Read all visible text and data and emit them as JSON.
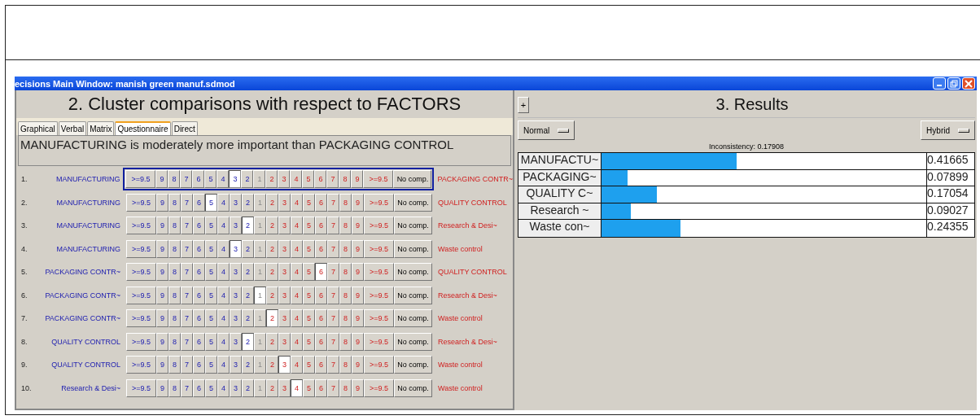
{
  "window": {
    "title": "ecisions Main Window: manish green manuf.sdmod"
  },
  "comparisons": {
    "title": "2. Cluster comparisons with respect to FACTORS",
    "tabs": [
      {
        "label": "Graphical",
        "selected": false
      },
      {
        "label": "Verbal",
        "selected": false
      },
      {
        "label": "Matrix",
        "selected": false
      },
      {
        "label": "Questionnaire",
        "selected": true
      },
      {
        "label": "Direct",
        "selected": false
      }
    ],
    "statement": "MANUFACTURING is moderately more important than  PACKAGING CONTROL",
    "rows": [
      {
        "number": "1.",
        "left": "MANUFACTURING",
        "right": "PACKAGING CONTR~",
        "focused": true,
        "buttons": [
          {
            "label": ">=9.5",
            "kind": "left",
            "selected": false
          },
          {
            "label": "9",
            "kind": "left",
            "selected": false
          },
          {
            "label": "8",
            "kind": "left",
            "selected": false
          },
          {
            "label": "7",
            "kind": "left",
            "selected": false
          },
          {
            "label": "6",
            "kind": "left",
            "selected": false
          },
          {
            "label": "5",
            "kind": "left",
            "selected": false
          },
          {
            "label": "4",
            "kind": "left",
            "selected": false
          },
          {
            "label": "3",
            "kind": "left",
            "selected": true
          },
          {
            "label": "2",
            "kind": "left",
            "selected": false
          },
          {
            "label": "1",
            "kind": "center",
            "selected": false
          },
          {
            "label": "2",
            "kind": "right",
            "selected": false
          },
          {
            "label": "3",
            "kind": "right",
            "selected": false
          },
          {
            "label": "4",
            "kind": "right",
            "selected": false
          },
          {
            "label": "5",
            "kind": "right",
            "selected": false
          },
          {
            "label": "6",
            "kind": "right",
            "selected": false
          },
          {
            "label": "7",
            "kind": "right",
            "selected": false
          },
          {
            "label": "8",
            "kind": "right",
            "selected": false
          },
          {
            "label": "9",
            "kind": "right",
            "selected": false
          },
          {
            "label": ">=9.5",
            "kind": "right",
            "selected": false
          },
          {
            "label": "No comp.",
            "kind": "none",
            "selected": false
          }
        ]
      },
      {
        "number": "2.",
        "left": "MANUFACTURING",
        "right": "QUALITY CONTROL",
        "focused": false,
        "buttons": [
          {
            "label": ">=9.5",
            "kind": "left",
            "selected": false
          },
          {
            "label": "9",
            "kind": "left",
            "selected": false
          },
          {
            "label": "8",
            "kind": "left",
            "selected": false
          },
          {
            "label": "7",
            "kind": "left",
            "selected": false
          },
          {
            "label": "6",
            "kind": "left",
            "selected": false
          },
          {
            "label": "5",
            "kind": "left",
            "selected": true
          },
          {
            "label": "4",
            "kind": "left",
            "selected": false
          },
          {
            "label": "3",
            "kind": "left",
            "selected": false
          },
          {
            "label": "2",
            "kind": "left",
            "selected": false
          },
          {
            "label": "1",
            "kind": "center",
            "selected": false
          },
          {
            "label": "2",
            "kind": "right",
            "selected": false
          },
          {
            "label": "3",
            "kind": "right",
            "selected": false
          },
          {
            "label": "4",
            "kind": "right",
            "selected": false
          },
          {
            "label": "5",
            "kind": "right",
            "selected": false
          },
          {
            "label": "6",
            "kind": "right",
            "selected": false
          },
          {
            "label": "7",
            "kind": "right",
            "selected": false
          },
          {
            "label": "8",
            "kind": "right",
            "selected": false
          },
          {
            "label": "9",
            "kind": "right",
            "selected": false
          },
          {
            "label": ">=9.5",
            "kind": "right",
            "selected": false
          },
          {
            "label": "No comp.",
            "kind": "none",
            "selected": false
          }
        ]
      },
      {
        "number": "3.",
        "left": "MANUFACTURING",
        "right": "Research & Desi~",
        "focused": false,
        "buttons": [
          {
            "label": ">=9.5",
            "kind": "left",
            "selected": false
          },
          {
            "label": "9",
            "kind": "left",
            "selected": false
          },
          {
            "label": "8",
            "kind": "left",
            "selected": false
          },
          {
            "label": "7",
            "kind": "left",
            "selected": false
          },
          {
            "label": "6",
            "kind": "left",
            "selected": false
          },
          {
            "label": "5",
            "kind": "left",
            "selected": false
          },
          {
            "label": "4",
            "kind": "left",
            "selected": false
          },
          {
            "label": "3",
            "kind": "left",
            "selected": false
          },
          {
            "label": "2",
            "kind": "left",
            "selected": true
          },
          {
            "label": "1",
            "kind": "center",
            "selected": false
          },
          {
            "label": "2",
            "kind": "right",
            "selected": false
          },
          {
            "label": "3",
            "kind": "right",
            "selected": false
          },
          {
            "label": "4",
            "kind": "right",
            "selected": false
          },
          {
            "label": "5",
            "kind": "right",
            "selected": false
          },
          {
            "label": "6",
            "kind": "right",
            "selected": false
          },
          {
            "label": "7",
            "kind": "right",
            "selected": false
          },
          {
            "label": "8",
            "kind": "right",
            "selected": false
          },
          {
            "label": "9",
            "kind": "right",
            "selected": false
          },
          {
            "label": ">=9.5",
            "kind": "right",
            "selected": false
          },
          {
            "label": "No comp.",
            "kind": "none",
            "selected": false
          }
        ]
      },
      {
        "number": "4.",
        "left": "MANUFACTURING",
        "right": "Waste control",
        "focused": false,
        "buttons": [
          {
            "label": ">=9.5",
            "kind": "left",
            "selected": false
          },
          {
            "label": "9",
            "kind": "left",
            "selected": false
          },
          {
            "label": "8",
            "kind": "left",
            "selected": false
          },
          {
            "label": "7",
            "kind": "left",
            "selected": false
          },
          {
            "label": "6",
            "kind": "left",
            "selected": false
          },
          {
            "label": "5",
            "kind": "left",
            "selected": false
          },
          {
            "label": "4",
            "kind": "left",
            "selected": false
          },
          {
            "label": "3",
            "kind": "left",
            "selected": true
          },
          {
            "label": "2",
            "kind": "left",
            "selected": false
          },
          {
            "label": "1",
            "kind": "center",
            "selected": false
          },
          {
            "label": "2",
            "kind": "right",
            "selected": false
          },
          {
            "label": "3",
            "kind": "right",
            "selected": false
          },
          {
            "label": "4",
            "kind": "right",
            "selected": false
          },
          {
            "label": "5",
            "kind": "right",
            "selected": false
          },
          {
            "label": "6",
            "kind": "right",
            "selected": false
          },
          {
            "label": "7",
            "kind": "right",
            "selected": false
          },
          {
            "label": "8",
            "kind": "right",
            "selected": false
          },
          {
            "label": "9",
            "kind": "right",
            "selected": false
          },
          {
            "label": ">=9.5",
            "kind": "right",
            "selected": false
          },
          {
            "label": "No comp.",
            "kind": "none",
            "selected": false
          }
        ]
      },
      {
        "number": "5.",
        "left": "PACKAGING CONTR~",
        "right": "QUALITY CONTROL",
        "focused": false,
        "buttons": [
          {
            "label": ">=9.5",
            "kind": "left",
            "selected": false
          },
          {
            "label": "9",
            "kind": "left",
            "selected": false
          },
          {
            "label": "8",
            "kind": "left",
            "selected": false
          },
          {
            "label": "7",
            "kind": "left",
            "selected": false
          },
          {
            "label": "6",
            "kind": "left",
            "selected": false
          },
          {
            "label": "5",
            "kind": "left",
            "selected": false
          },
          {
            "label": "4",
            "kind": "left",
            "selected": false
          },
          {
            "label": "3",
            "kind": "left",
            "selected": false
          },
          {
            "label": "2",
            "kind": "left",
            "selected": false
          },
          {
            "label": "1",
            "kind": "center",
            "selected": false
          },
          {
            "label": "2",
            "kind": "right",
            "selected": false
          },
          {
            "label": "3",
            "kind": "right",
            "selected": false
          },
          {
            "label": "4",
            "kind": "right",
            "selected": false
          },
          {
            "label": "5",
            "kind": "right",
            "selected": false
          },
          {
            "label": "6",
            "kind": "right",
            "selected": true
          },
          {
            "label": "7",
            "kind": "right",
            "selected": false
          },
          {
            "label": "8",
            "kind": "right",
            "selected": false
          },
          {
            "label": "9",
            "kind": "right",
            "selected": false
          },
          {
            "label": ">=9.5",
            "kind": "right",
            "selected": false
          },
          {
            "label": "No comp.",
            "kind": "none",
            "selected": false
          }
        ]
      },
      {
        "number": "6.",
        "left": "PACKAGING CONTR~",
        "right": "Research & Desi~",
        "focused": false,
        "buttons": [
          {
            "label": ">=9.5",
            "kind": "left",
            "selected": false
          },
          {
            "label": "9",
            "kind": "left",
            "selected": false
          },
          {
            "label": "8",
            "kind": "left",
            "selected": false
          },
          {
            "label": "7",
            "kind": "left",
            "selected": false
          },
          {
            "label": "6",
            "kind": "left",
            "selected": false
          },
          {
            "label": "5",
            "kind": "left",
            "selected": false
          },
          {
            "label": "4",
            "kind": "left",
            "selected": false
          },
          {
            "label": "3",
            "kind": "left",
            "selected": false
          },
          {
            "label": "2",
            "kind": "left",
            "selected": false
          },
          {
            "label": "1",
            "kind": "center",
            "selected": true
          },
          {
            "label": "2",
            "kind": "right",
            "selected": false
          },
          {
            "label": "3",
            "kind": "right",
            "selected": false
          },
          {
            "label": "4",
            "kind": "right",
            "selected": false
          },
          {
            "label": "5",
            "kind": "right",
            "selected": false
          },
          {
            "label": "6",
            "kind": "right",
            "selected": false
          },
          {
            "label": "7",
            "kind": "right",
            "selected": false
          },
          {
            "label": "8",
            "kind": "right",
            "selected": false
          },
          {
            "label": "9",
            "kind": "right",
            "selected": false
          },
          {
            "label": ">=9.5",
            "kind": "right",
            "selected": false
          },
          {
            "label": "No comp.",
            "kind": "none",
            "selected": false
          }
        ]
      },
      {
        "number": "7.",
        "left": "PACKAGING CONTR~",
        "right": "Waste control",
        "focused": false,
        "buttons": [
          {
            "label": ">=9.5",
            "kind": "left",
            "selected": false
          },
          {
            "label": "9",
            "kind": "left",
            "selected": false
          },
          {
            "label": "8",
            "kind": "left",
            "selected": false
          },
          {
            "label": "7",
            "kind": "left",
            "selected": false
          },
          {
            "label": "6",
            "kind": "left",
            "selected": false
          },
          {
            "label": "5",
            "kind": "left",
            "selected": false
          },
          {
            "label": "4",
            "kind": "left",
            "selected": false
          },
          {
            "label": "3",
            "kind": "left",
            "selected": false
          },
          {
            "label": "2",
            "kind": "left",
            "selected": false
          },
          {
            "label": "1",
            "kind": "center",
            "selected": false
          },
          {
            "label": "2",
            "kind": "right",
            "selected": true
          },
          {
            "label": "3",
            "kind": "right",
            "selected": false
          },
          {
            "label": "4",
            "kind": "right",
            "selected": false
          },
          {
            "label": "5",
            "kind": "right",
            "selected": false
          },
          {
            "label": "6",
            "kind": "right",
            "selected": false
          },
          {
            "label": "7",
            "kind": "right",
            "selected": false
          },
          {
            "label": "8",
            "kind": "right",
            "selected": false
          },
          {
            "label": "9",
            "kind": "right",
            "selected": false
          },
          {
            "label": ">=9.5",
            "kind": "right",
            "selected": false
          },
          {
            "label": "No comp.",
            "kind": "none",
            "selected": false
          }
        ]
      },
      {
        "number": "8.",
        "left": "QUALITY CONTROL",
        "right": "Research & Desi~",
        "focused": false,
        "buttons": [
          {
            "label": ">=9.5",
            "kind": "left",
            "selected": false
          },
          {
            "label": "9",
            "kind": "left",
            "selected": false
          },
          {
            "label": "8",
            "kind": "left",
            "selected": false
          },
          {
            "label": "7",
            "kind": "left",
            "selected": false
          },
          {
            "label": "6",
            "kind": "left",
            "selected": false
          },
          {
            "label": "5",
            "kind": "left",
            "selected": false
          },
          {
            "label": "4",
            "kind": "left",
            "selected": false
          },
          {
            "label": "3",
            "kind": "left",
            "selected": false
          },
          {
            "label": "2",
            "kind": "left",
            "selected": true
          },
          {
            "label": "1",
            "kind": "center",
            "selected": false
          },
          {
            "label": "2",
            "kind": "right",
            "selected": false
          },
          {
            "label": "3",
            "kind": "right",
            "selected": false
          },
          {
            "label": "4",
            "kind": "right",
            "selected": false
          },
          {
            "label": "5",
            "kind": "right",
            "selected": false
          },
          {
            "label": "6",
            "kind": "right",
            "selected": false
          },
          {
            "label": "7",
            "kind": "right",
            "selected": false
          },
          {
            "label": "8",
            "kind": "right",
            "selected": false
          },
          {
            "label": "9",
            "kind": "right",
            "selected": false
          },
          {
            "label": ">=9.5",
            "kind": "right",
            "selected": false
          },
          {
            "label": "No comp.",
            "kind": "none",
            "selected": false
          }
        ]
      },
      {
        "number": "9.",
        "left": "QUALITY CONTROL",
        "right": "Waste control",
        "focused": false,
        "buttons": [
          {
            "label": ">=9.5",
            "kind": "left",
            "selected": false
          },
          {
            "label": "9",
            "kind": "left",
            "selected": false
          },
          {
            "label": "8",
            "kind": "left",
            "selected": false
          },
          {
            "label": "7",
            "kind": "left",
            "selected": false
          },
          {
            "label": "6",
            "kind": "left",
            "selected": false
          },
          {
            "label": "5",
            "kind": "left",
            "selected": false
          },
          {
            "label": "4",
            "kind": "left",
            "selected": false
          },
          {
            "label": "3",
            "kind": "left",
            "selected": false
          },
          {
            "label": "2",
            "kind": "left",
            "selected": false
          },
          {
            "label": "1",
            "kind": "center",
            "selected": false
          },
          {
            "label": "2",
            "kind": "right",
            "selected": false
          },
          {
            "label": "3",
            "kind": "right",
            "selected": true
          },
          {
            "label": "4",
            "kind": "right",
            "selected": false
          },
          {
            "label": "5",
            "kind": "right",
            "selected": false
          },
          {
            "label": "6",
            "kind": "right",
            "selected": false
          },
          {
            "label": "7",
            "kind": "right",
            "selected": false
          },
          {
            "label": "8",
            "kind": "right",
            "selected": false
          },
          {
            "label": "9",
            "kind": "right",
            "selected": false
          },
          {
            "label": ">=9.5",
            "kind": "right",
            "selected": false
          },
          {
            "label": "No comp.",
            "kind": "none",
            "selected": false
          }
        ]
      },
      {
        "number": "10.",
        "left": "Research & Desi~",
        "right": "Waste control",
        "focused": false,
        "buttons": [
          {
            "label": ">=9.5",
            "kind": "left",
            "selected": false
          },
          {
            "label": "9",
            "kind": "left",
            "selected": false
          },
          {
            "label": "8",
            "kind": "left",
            "selected": false
          },
          {
            "label": "7",
            "kind": "left",
            "selected": false
          },
          {
            "label": "6",
            "kind": "left",
            "selected": false
          },
          {
            "label": "5",
            "kind": "left",
            "selected": false
          },
          {
            "label": "4",
            "kind": "left",
            "selected": false
          },
          {
            "label": "3",
            "kind": "left",
            "selected": false
          },
          {
            "label": "2",
            "kind": "left",
            "selected": false
          },
          {
            "label": "1",
            "kind": "center",
            "selected": false
          },
          {
            "label": "2",
            "kind": "right",
            "selected": false
          },
          {
            "label": "3",
            "kind": "right",
            "selected": false
          },
          {
            "label": "4",
            "kind": "right",
            "selected": true
          },
          {
            "label": "5",
            "kind": "right",
            "selected": false
          },
          {
            "label": "6",
            "kind": "right",
            "selected": false
          },
          {
            "label": "7",
            "kind": "right",
            "selected": false
          },
          {
            "label": "8",
            "kind": "right",
            "selected": false
          },
          {
            "label": "9",
            "kind": "right",
            "selected": false
          },
          {
            "label": ">=9.5",
            "kind": "right",
            "selected": false
          },
          {
            "label": "No comp.",
            "kind": "none",
            "selected": false
          }
        ]
      }
    ]
  },
  "results": {
    "expand_button": "+",
    "title": "3. Results",
    "mode_dropdown": "Normal",
    "type_dropdown": "Hybrid",
    "inconsistency": "Inconsistency: 0.17908",
    "rows": [
      {
        "name": "MANUFACTU~",
        "level": 0.41665,
        "value": "0.41665"
      },
      {
        "name": "PACKAGING~",
        "level": 0.07899,
        "value": "0.07899"
      },
      {
        "name": "QUALITY C~",
        "level": 0.17054,
        "value": "0.17054"
      },
      {
        "name": "Research ~",
        "level": 0.09027,
        "value": "0.09027"
      },
      {
        "name": "Waste con~",
        "level": 0.24355,
        "value": "0.24355"
      }
    ]
  }
}
